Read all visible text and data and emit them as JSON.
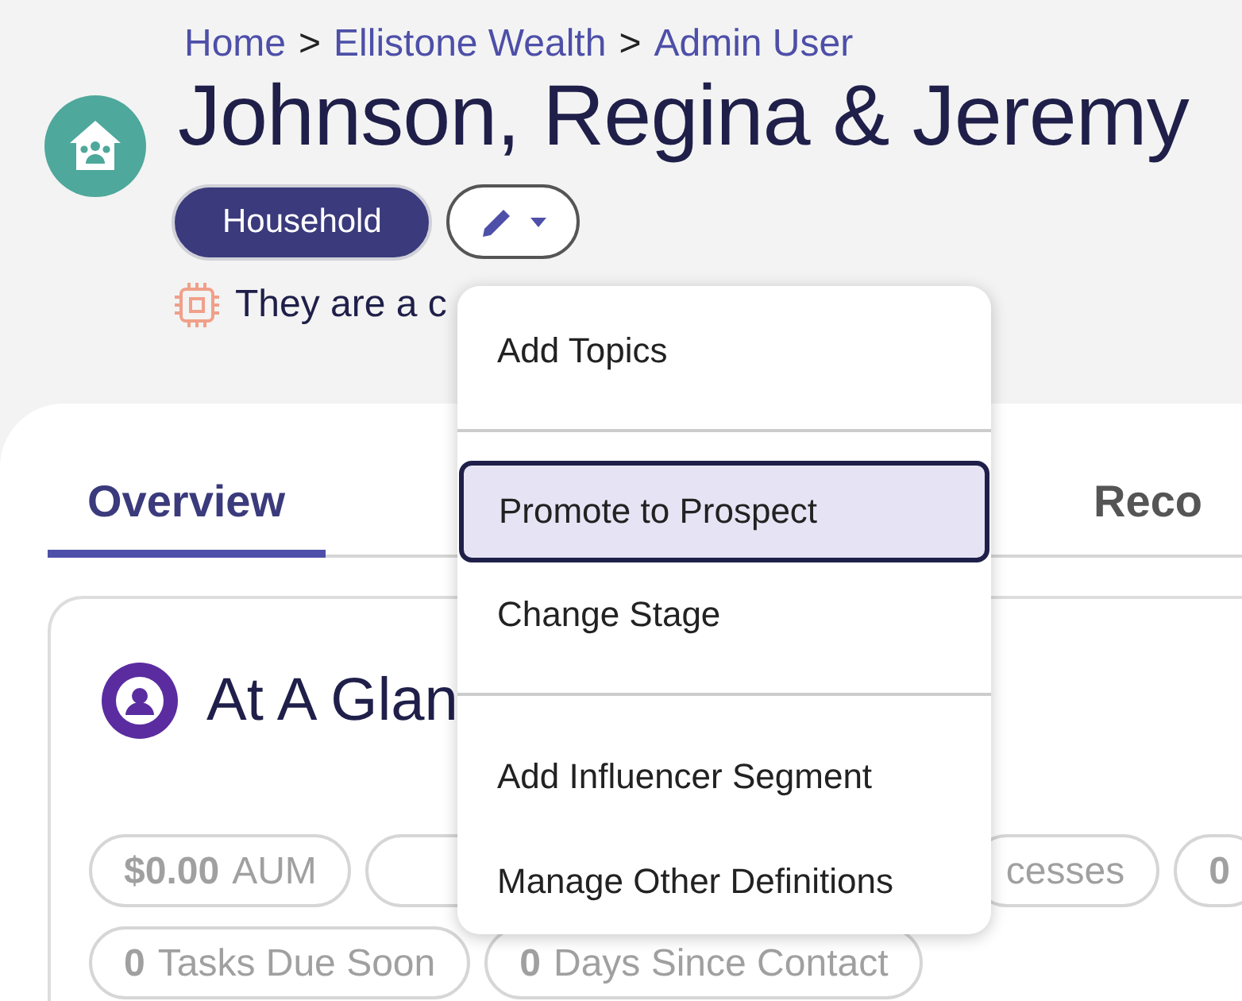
{
  "breadcrumb": [
    {
      "label": "Home"
    },
    {
      "label": "Ellistone Wealth"
    },
    {
      "label": "Admin User"
    }
  ],
  "breadcrumb_separator": ">",
  "title": "Johnson, Regina & Jeremy",
  "type_badge": "Household",
  "note": "They are a c",
  "menu": {
    "sections": [
      {
        "items": [
          {
            "label": "Add Topics",
            "selected": false
          }
        ]
      },
      {
        "items": [
          {
            "label": "Promote to Prospect",
            "selected": true
          },
          {
            "label": "Change Stage",
            "selected": false
          }
        ]
      },
      {
        "items": [
          {
            "label": "Add Influencer Segment",
            "selected": false
          },
          {
            "label": "Manage Other Definitions",
            "selected": false
          }
        ]
      }
    ]
  },
  "tabs": [
    {
      "label": "Overview",
      "selected": true
    },
    {
      "label": "Reco",
      "selected": false
    }
  ],
  "card": {
    "title": "At A Glan",
    "chip_rows": [
      [
        {
          "value": "$0.00",
          "label": "AUM"
        },
        {},
        {
          "label": "cesses"
        },
        {
          "value": "0"
        }
      ],
      [
        {
          "value": "0",
          "label": "Tasks Due Soon"
        },
        {
          "value": "0",
          "label": "Days Since Contact"
        }
      ]
    ]
  }
}
